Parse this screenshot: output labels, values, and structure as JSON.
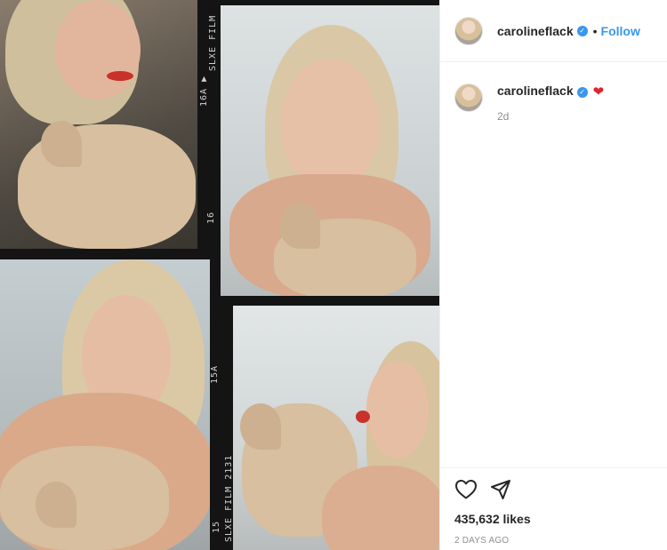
{
  "post": {
    "author": {
      "username": "carolineflack",
      "verified": true,
      "verified_icon": "verified-badge-icon"
    },
    "follow_separator": "•",
    "follow_label": "Follow",
    "caption": {
      "username": "carolineflack",
      "emoji": "❤",
      "time_ago": "2d"
    },
    "actions": {
      "like_icon": "heart-outline-icon",
      "share_icon": "paper-plane-icon"
    },
    "likes_label": "435,632 likes",
    "date_label": "2 DAYS AGO"
  },
  "photo": {
    "film_labels": [
      "16A",
      "SLXE FILM",
      "16",
      "15A",
      "SLXE FILM 2131",
      "15"
    ]
  }
}
